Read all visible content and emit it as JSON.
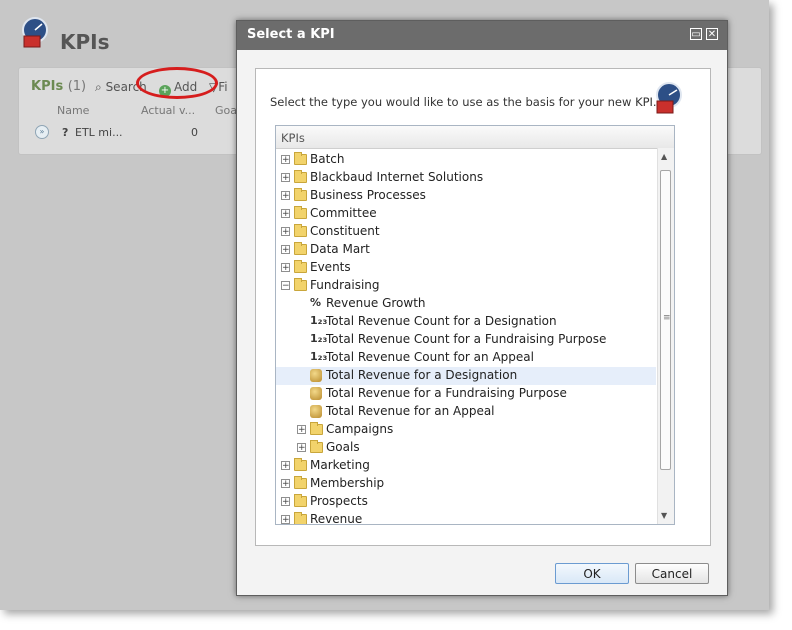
{
  "page": {
    "title": "KPIs",
    "panel_header": "KPIs",
    "panel_count": "(1)",
    "toolbar": {
      "search": "Search",
      "add": "Add",
      "filter": "Fi"
    },
    "columns": {
      "name": "Name",
      "actual": "Actual v...",
      "goal": "Goa"
    },
    "row": {
      "name": "ETL mi...",
      "actual": "0"
    }
  },
  "dialog": {
    "title": "Select a KPI",
    "instruction": "Select the type you would like to use as the basis for your new KPI.",
    "tree_header": "KPIs",
    "tree": [
      {
        "label": "Batch",
        "level": 0,
        "kind": "folder",
        "expander": "+"
      },
      {
        "label": "Blackbaud Internet Solutions",
        "level": 0,
        "kind": "folder",
        "expander": "+"
      },
      {
        "label": "Business Processes",
        "level": 0,
        "kind": "folder",
        "expander": "+"
      },
      {
        "label": "Committee",
        "level": 0,
        "kind": "folder",
        "expander": "+"
      },
      {
        "label": "Constituent",
        "level": 0,
        "kind": "folder",
        "expander": "+"
      },
      {
        "label": "Data Mart",
        "level": 0,
        "kind": "folder",
        "expander": "+"
      },
      {
        "label": "Events",
        "level": 0,
        "kind": "folder",
        "expander": "+"
      },
      {
        "label": "Fundraising",
        "level": 0,
        "kind": "folder-open",
        "expander": "−"
      },
      {
        "label": "Revenue Growth",
        "level": 1,
        "kind": "percent",
        "icon": "%"
      },
      {
        "label": "Total Revenue Count for a Designation",
        "level": 1,
        "kind": "count",
        "icon": "1₂₃"
      },
      {
        "label": "Total Revenue Count for a Fundraising Purpose",
        "level": 1,
        "kind": "count",
        "icon": "1₂₃"
      },
      {
        "label": "Total Revenue Count for an Appeal",
        "level": 1,
        "kind": "count",
        "icon": "1₂₃"
      },
      {
        "label": "Total Revenue for a Designation",
        "level": 1,
        "kind": "coin",
        "selected": true
      },
      {
        "label": "Total Revenue for a Fundraising Purpose",
        "level": 1,
        "kind": "coin"
      },
      {
        "label": "Total Revenue for an Appeal",
        "level": 1,
        "kind": "coin"
      },
      {
        "label": "Campaigns",
        "level": 1,
        "kind": "folder",
        "expander": "+"
      },
      {
        "label": "Goals",
        "level": 1,
        "kind": "folder",
        "expander": "+"
      },
      {
        "label": "Marketing",
        "level": 0,
        "kind": "folder",
        "expander": "+"
      },
      {
        "label": "Membership",
        "level": 0,
        "kind": "folder",
        "expander": "+"
      },
      {
        "label": "Prospects",
        "level": 0,
        "kind": "folder",
        "expander": "+"
      },
      {
        "label": "Revenue",
        "level": 0,
        "kind": "folder",
        "expander": "+"
      }
    ],
    "ok_label": "OK",
    "cancel_label": "Cancel"
  }
}
